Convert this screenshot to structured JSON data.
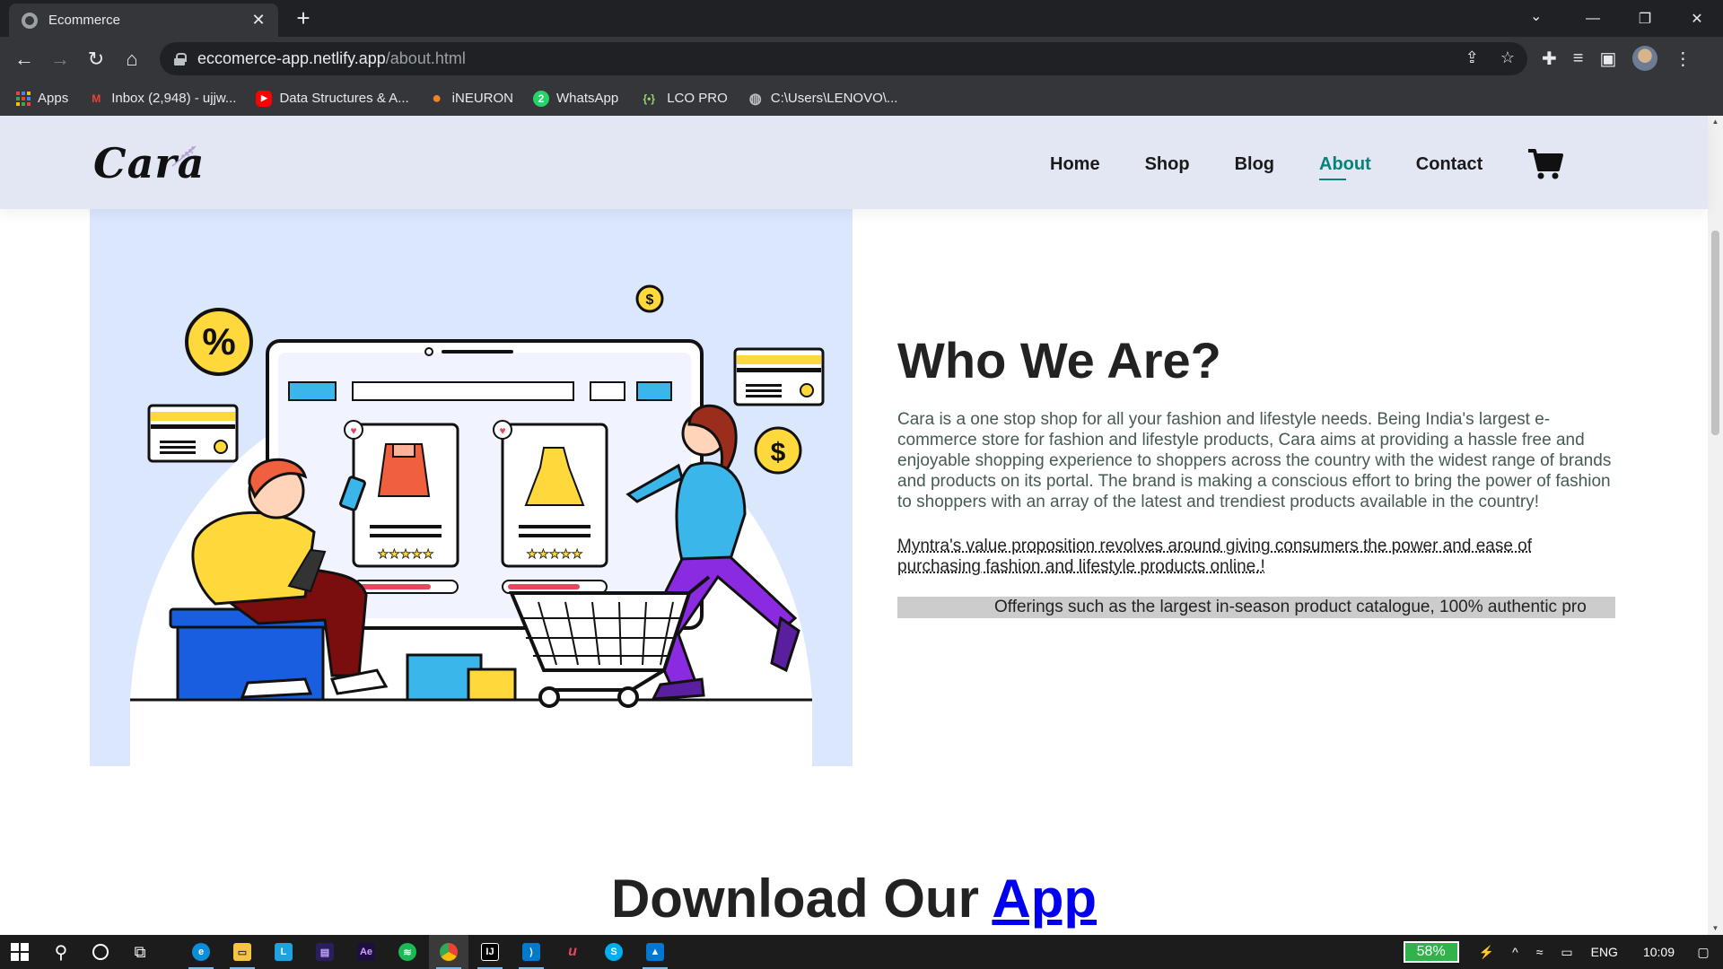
{
  "browser": {
    "tab_title": "Ecommerce",
    "tab_close": "✕",
    "new_tab": "+",
    "url_host": "eccomerce-app.netlify.app",
    "url_path": "/about.html",
    "bookmarks": [
      {
        "label": "Apps",
        "icon": "apps-grid-icon"
      },
      {
        "label": "Inbox (2,948) - ujjw...",
        "icon": "gmail-icon",
        "color": "#ea4335",
        "glyph": "M"
      },
      {
        "label": "Data Structures & A...",
        "icon": "youtube-icon",
        "color": "#ff0000",
        "glyph": "▶"
      },
      {
        "label": "iNEURON",
        "icon": "ineuron-icon",
        "color": "#f5811f",
        "glyph": "●"
      },
      {
        "label": "WhatsApp",
        "icon": "whatsapp-icon",
        "color": "#25d366",
        "glyph": "2"
      },
      {
        "label": "LCO PRO",
        "icon": "lco-icon",
        "color": "#35363a",
        "glyph": "{•}"
      },
      {
        "label": "C:\\Users\\LENOVO\\...",
        "icon": "globe-icon",
        "color": "#9aa0a6",
        "glyph": "◍"
      }
    ]
  },
  "site": {
    "logo": "Cara",
    "nav": [
      {
        "label": "Home",
        "active": false
      },
      {
        "label": "Shop",
        "active": false
      },
      {
        "label": "Blog",
        "active": false
      },
      {
        "label": "About",
        "active": true
      },
      {
        "label": "Contact",
        "active": false
      }
    ],
    "accent_color": "#088178",
    "header_bg": "#e3e6f3"
  },
  "about": {
    "title": "Who We Are?",
    "paragraph": "Cara is a one stop shop for all your fashion and lifestyle needs. Being India's largest e-commerce store for fashion and lifestyle products, Cara aims at providing a hassle free and enjoyable shopping experience to shoppers across the country with the widest range of brands and products on its portal. The brand is making a conscious effort to bring the power of fashion to shoppers with an array of the latest and trendiest products available in the country!",
    "abbr_text": "Myntra's value proposition revolves around giving consumers the power and ease of purchasing fashion and lifestyle products online.!",
    "marquee": "Offerings such as the largest in-season product catalogue, 100% authentic pro"
  },
  "download": {
    "prefix": "Download Our ",
    "link": "App"
  },
  "taskbar": {
    "battery": "58%",
    "language": "ENG",
    "time": "10:09"
  }
}
